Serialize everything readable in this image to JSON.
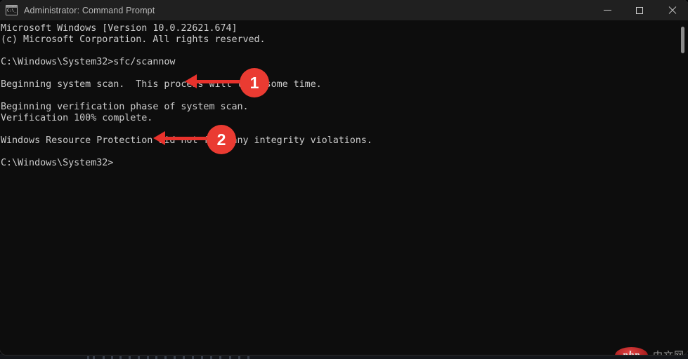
{
  "window": {
    "title": "Administrator: Command Prompt",
    "app_icon": "cmd-icon",
    "icon_prompt_text": "C:\\_",
    "controls": {
      "minimize": "minimize-button",
      "maximize": "maximize-button",
      "close": "close-button"
    },
    "colors": {
      "titlebar_bg": "#202020",
      "console_bg": "#0d0d0d",
      "console_text": "#cccccc",
      "annotation_red": "#ea3b32",
      "close_hover": "#c42b1c"
    }
  },
  "console": {
    "lines": [
      "Microsoft Windows [Version 10.0.22621.674]",
      "(c) Microsoft Corporation. All rights reserved.",
      "",
      "C:\\Windows\\System32>sfc/scannow",
      "",
      "Beginning system scan.  This process will take some time.",
      "",
      "Beginning verification phase of system scan.",
      "Verification 100% complete.",
      "",
      "Windows Resource Protection did not find any integrity violations.",
      "",
      "C:\\Windows\\System32>"
    ],
    "command": "sfc/scannow",
    "prompt": "C:\\Windows\\System32>",
    "verification_percent": "100%",
    "scrollbar": "vertical-scrollbar"
  },
  "annotations": [
    {
      "label": "1",
      "target": "sfc/scannow command line"
    },
    {
      "label": "2",
      "target": "Verification 100% complete."
    }
  ],
  "watermark": {
    "logo_text": "php",
    "site_text": "中文网"
  }
}
